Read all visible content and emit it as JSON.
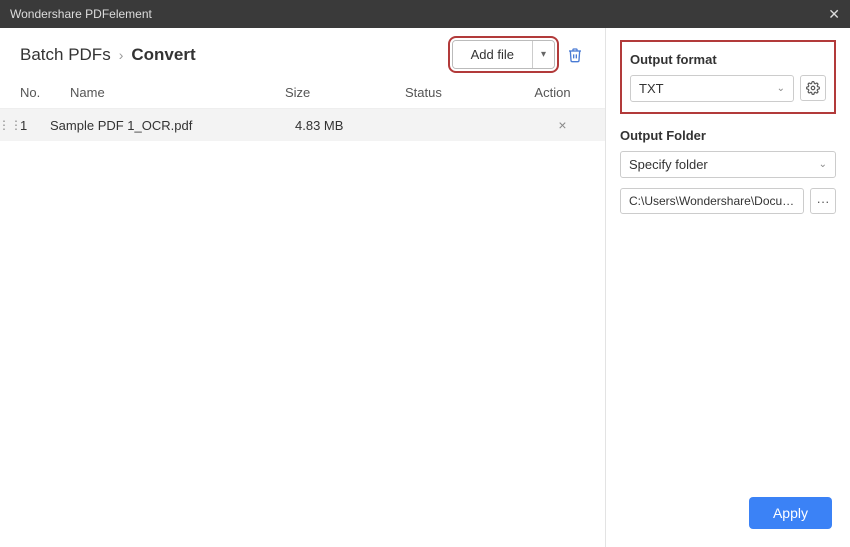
{
  "titlebar": {
    "app_name": "Wondershare PDFelement"
  },
  "breadcrumb": {
    "root": "Batch PDFs",
    "current": "Convert"
  },
  "toolbar": {
    "add_file": "Add file"
  },
  "table": {
    "headers": {
      "no": "No.",
      "name": "Name",
      "size": "Size",
      "status": "Status",
      "action": "Action"
    },
    "rows": [
      {
        "no": "1",
        "name": "Sample PDF 1_OCR.pdf",
        "size": "4.83 MB",
        "status": ""
      }
    ]
  },
  "right": {
    "output_format_label": "Output format",
    "output_format_value": "TXT",
    "output_folder_label": "Output Folder",
    "specify_folder": "Specify folder",
    "path": "C:\\Users\\Wondershare\\Documents",
    "apply": "Apply"
  }
}
